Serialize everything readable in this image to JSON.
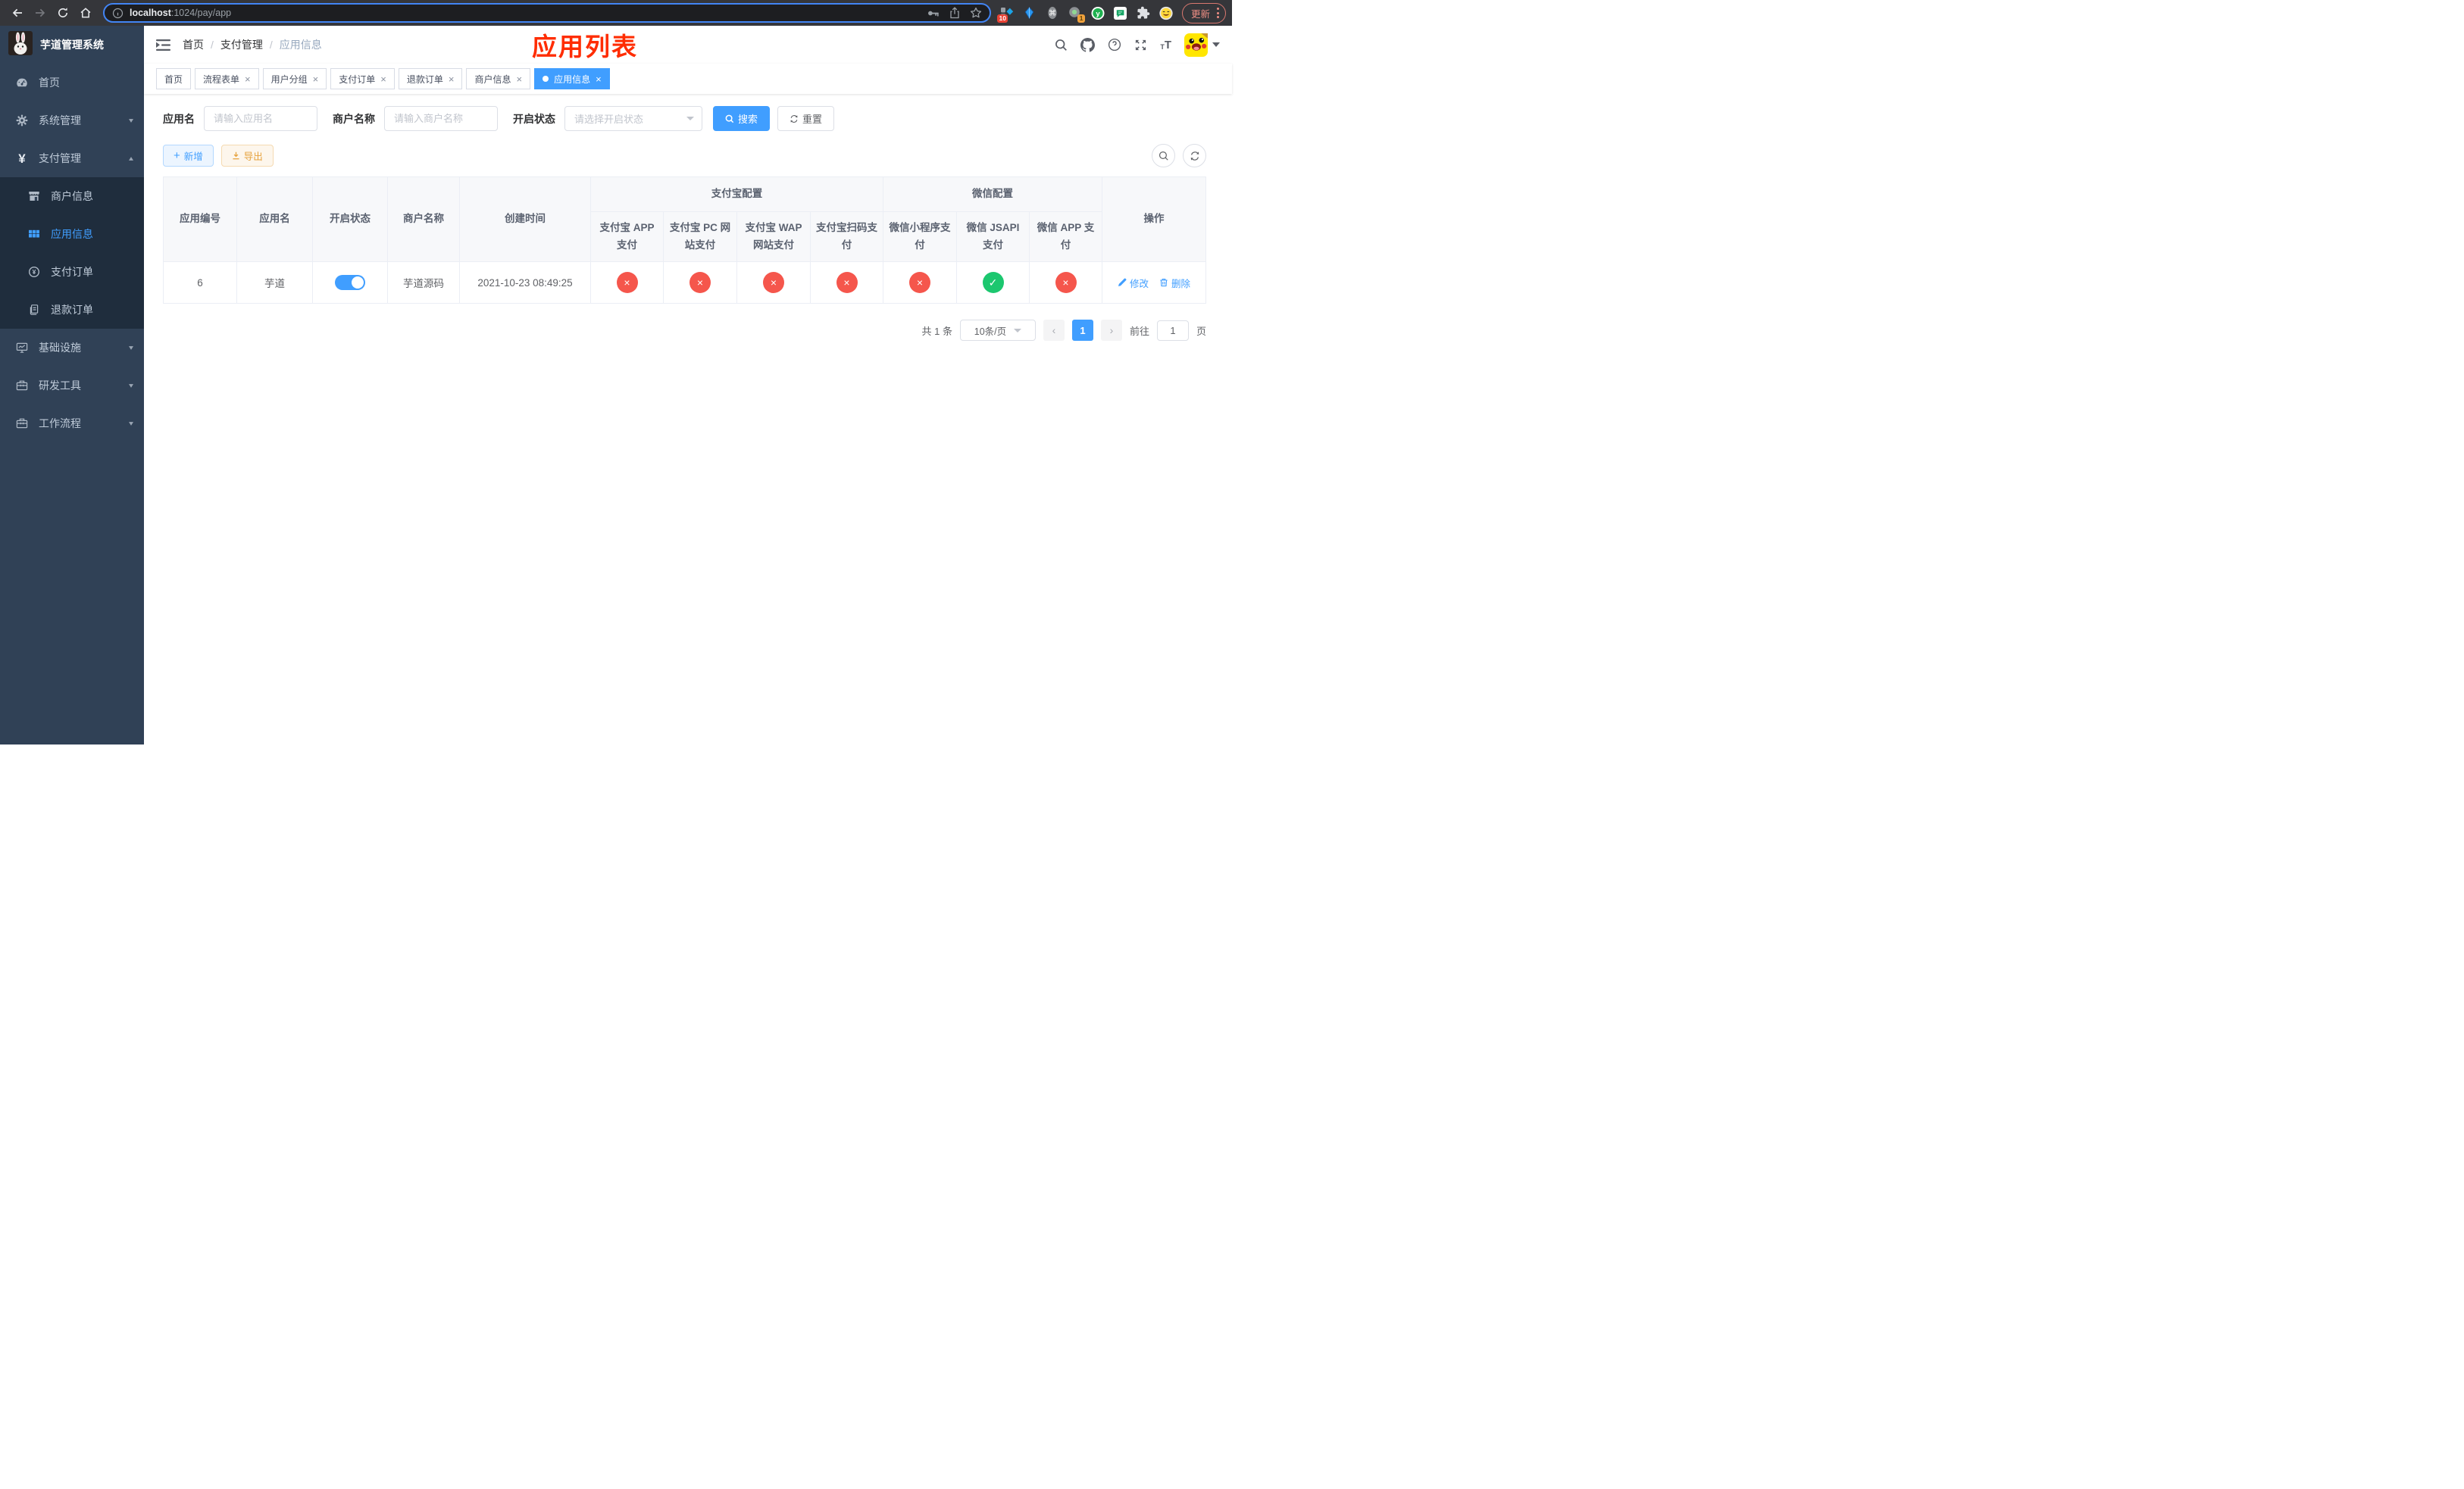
{
  "browser": {
    "url_host": "localhost",
    "url_path": ":1024/pay/app",
    "update_label": "更新",
    "ext_badge_sidebar": "10",
    "ext_badge_media": "1"
  },
  "sidebar": {
    "title": "芋道管理系统",
    "items": [
      {
        "key": "home",
        "label": "首页",
        "icon": "dashboard",
        "type": "item"
      },
      {
        "key": "system",
        "label": "系统管理",
        "icon": "gear",
        "type": "parent",
        "chevron": "down"
      },
      {
        "key": "payment",
        "label": "支付管理",
        "icon": "yen",
        "type": "parent",
        "chevron": "up"
      },
      {
        "key": "merchant-info",
        "label": "商户信息",
        "icon": "store",
        "type": "sub"
      },
      {
        "key": "app-info",
        "label": "应用信息",
        "icon": "grid",
        "type": "sub",
        "active": true
      },
      {
        "key": "pay-order",
        "label": "支付订单",
        "icon": "yen-circle",
        "type": "sub"
      },
      {
        "key": "refund-order",
        "label": "退款订单",
        "icon": "doc",
        "type": "sub"
      },
      {
        "key": "infrastructure",
        "label": "基础设施",
        "icon": "monitor",
        "type": "parent",
        "chevron": "down"
      },
      {
        "key": "dev-tools",
        "label": "研发工具",
        "icon": "toolbox",
        "type": "parent",
        "chevron": "down"
      },
      {
        "key": "workflow",
        "label": "工作流程",
        "icon": "toolbox",
        "type": "parent",
        "chevron": "down"
      }
    ]
  },
  "header": {
    "breadcrumb": [
      "首页",
      "支付管理",
      "应用信息"
    ],
    "separator": "/",
    "annotation": "应用列表"
  },
  "tabs": [
    {
      "key": "home",
      "label": "首页",
      "closable": false,
      "active": false
    },
    {
      "key": "process-form",
      "label": "流程表单",
      "closable": true,
      "active": false
    },
    {
      "key": "user-group",
      "label": "用户分组",
      "closable": true,
      "active": false
    },
    {
      "key": "pay-order",
      "label": "支付订单",
      "closable": true,
      "active": false
    },
    {
      "key": "refund-order",
      "label": "退款订单",
      "closable": true,
      "active": false
    },
    {
      "key": "merchant-info",
      "label": "商户信息",
      "closable": true,
      "active": false
    },
    {
      "key": "app-info",
      "label": "应用信息",
      "closable": true,
      "active": true
    }
  ],
  "filters": {
    "app_name_label": "应用名",
    "app_name_placeholder": "请输入应用名",
    "merchant_label": "商户名称",
    "merchant_placeholder": "请输入商户名称",
    "status_label": "开启状态",
    "status_placeholder": "请选择开启状态",
    "search_label": "搜索",
    "reset_label": "重置"
  },
  "toolbar": {
    "add_label": "新增",
    "export_label": "导出"
  },
  "table": {
    "columns": [
      "应用编号",
      "应用名",
      "开启状态",
      "商户名称",
      "创建时间"
    ],
    "group_alipay": "支付宝配置",
    "alipay_columns": [
      "支付宝 APP 支付",
      "支付宝 PC 网站支付",
      "支付宝 WAP 网站支付",
      "支付宝扫码支付"
    ],
    "group_wechat": "微信配置",
    "wechat_columns": [
      "微信小程序支付",
      "微信 JSAPI 支付",
      "微信 APP 支付"
    ],
    "action_column": "操作",
    "rows": [
      {
        "id": "6",
        "name": "芋道",
        "enabled": true,
        "merchant": "芋道源码",
        "created": "2021-10-23 08:49:25",
        "statuses": [
          {
            "key": "alipay-app",
            "state": "fail"
          },
          {
            "key": "alipay-pc",
            "state": "fail"
          },
          {
            "key": "alipay-wap",
            "state": "fail"
          },
          {
            "key": "alipay-qr",
            "state": "fail"
          },
          {
            "key": "wechat-lite",
            "state": "fail"
          },
          {
            "key": "wechat-jsapi",
            "state": "success"
          },
          {
            "key": "wechat-app",
            "state": "fail"
          }
        ],
        "edit_label": "修改",
        "delete_label": "删除"
      }
    ]
  },
  "pagination": {
    "total": "共 1 条",
    "page_size": "10条/页",
    "current_page": "1",
    "goto_label": "前往",
    "goto_value": "1",
    "page_unit": "页"
  },
  "colors": {
    "primary": "#409eff",
    "success": "#1cc76f",
    "danger": "#f5564c",
    "warning": "#e6a23c",
    "annotation_red": "#ff2d02",
    "sidebar_bg": "#304156",
    "submenu_bg": "#1f2d3d"
  }
}
